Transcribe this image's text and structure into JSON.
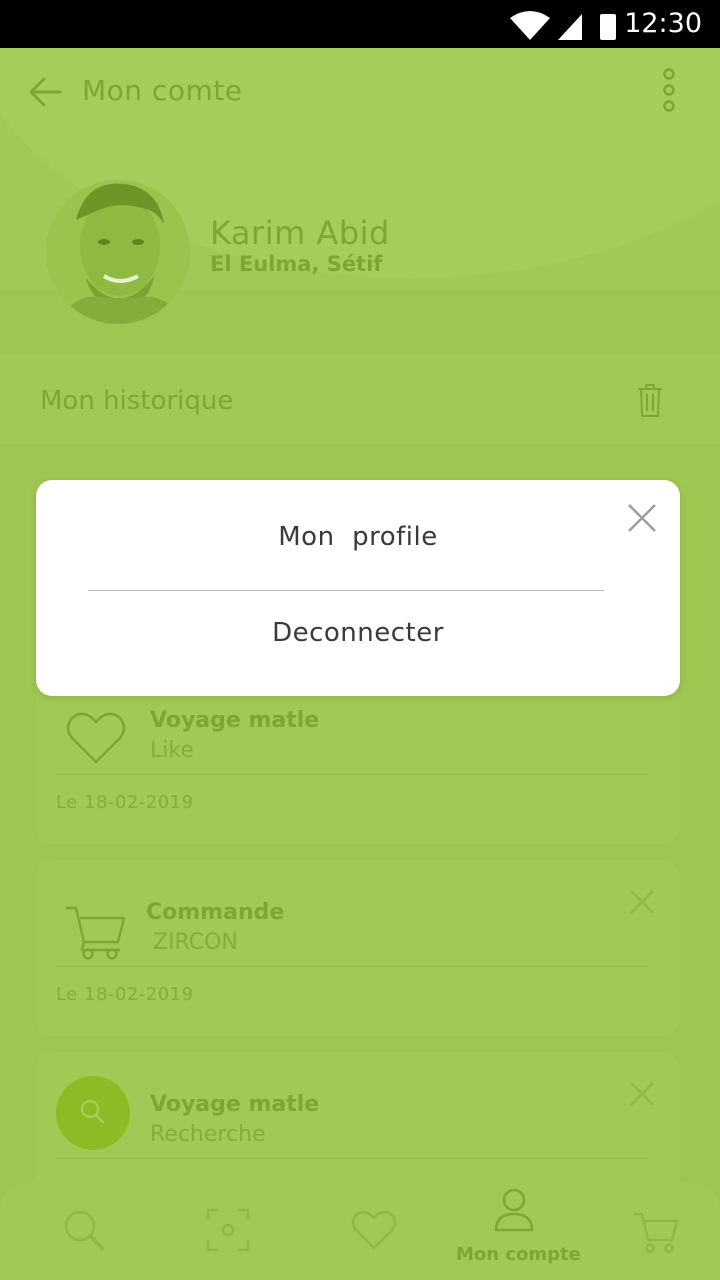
{
  "status_bar": {
    "time": "12:30"
  },
  "header": {
    "title": "Mon comte"
  },
  "profile": {
    "name": "Karim Abid",
    "location": "El Eulma, Sétif"
  },
  "history": {
    "title": "Mon historique"
  },
  "modal": {
    "item_profile": "Mon  profile",
    "item_logout": "Deconnecter"
  },
  "cards": [
    {
      "title": "Voyage matle",
      "subtitle": "Like",
      "date": "Le  18-02-2019",
      "icon": "heart-icon"
    },
    {
      "title": "Commande",
      "subtitle": " ZIRCON",
      "date": "Le  18-02-2019",
      "icon": "cart-icon"
    },
    {
      "title": "Voyage matle",
      "subtitle": "Recherche",
      "icon": "search-icon"
    }
  ],
  "bottom_nav": {
    "active_label": "Mon compte"
  },
  "colors": {
    "background": "#9fc651",
    "accent": "#7ea633",
    "modal": "#ffffff"
  }
}
